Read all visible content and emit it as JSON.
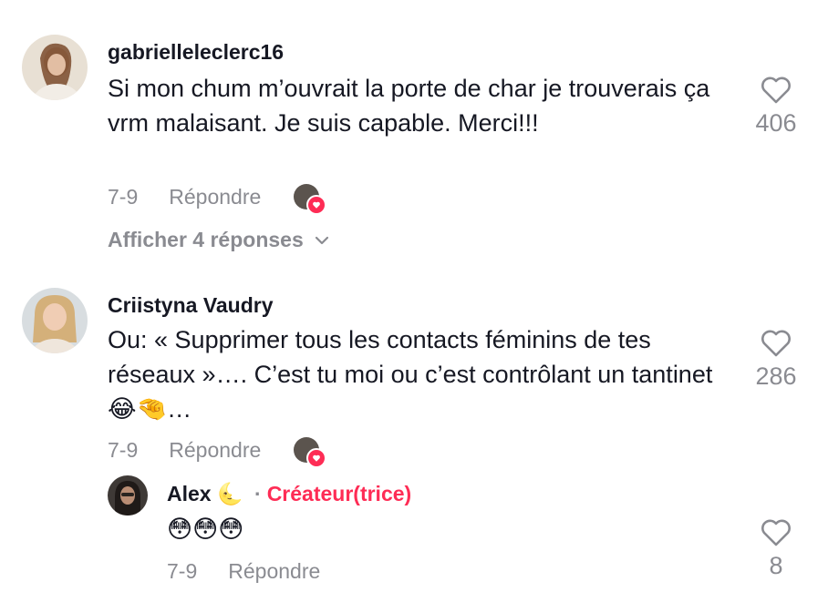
{
  "comments": [
    {
      "username": "gabrielleleclerc16",
      "text": "Si mon chum m’ouvrait la porte de char je trouverais ça vrm malaisant. Je suis capable. Merci!!!",
      "date": "7-9",
      "reply_label": "Répondre",
      "likes": "406",
      "view_replies": "Afficher 4 réponses"
    },
    {
      "username": "Criistyna Vaudry",
      "text": "Ou: « Supprimer tous les contacts féminins de tes réseaux »…. C’est tu moi ou c’est contrôlant un tantinet 😂🤏…",
      "date": "7-9",
      "reply_label": "Répondre",
      "likes": "286"
    }
  ],
  "reply": {
    "username": "Alex",
    "username_emoji": "🌜",
    "separator": "·",
    "creator_label": "Créateur(trice)",
    "text": "😳😳😳",
    "date": "7-9",
    "reply_label": "Répondre",
    "likes": "8"
  },
  "colors": {
    "accent": "#fe2c55",
    "secondary_text": "#8a8b91",
    "primary_text": "#161823"
  }
}
